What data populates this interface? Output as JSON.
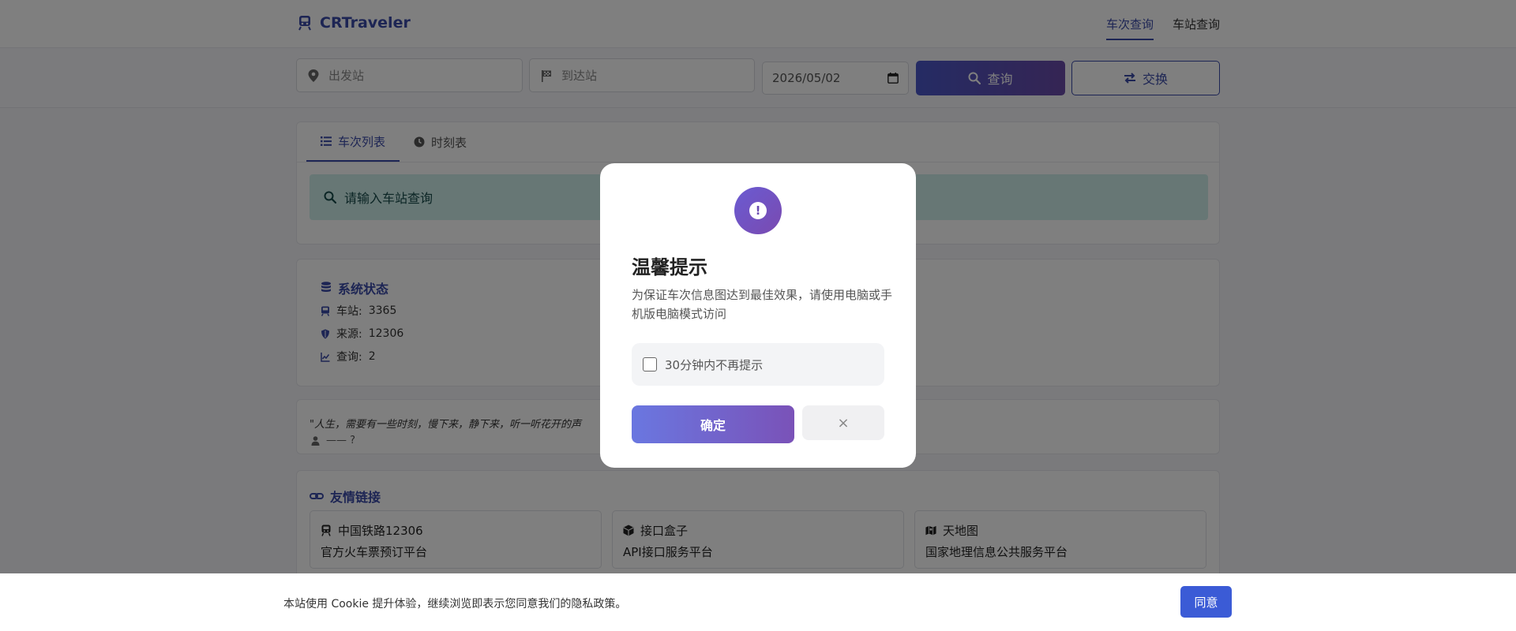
{
  "navbar": {
    "brand": "CRTraveler",
    "links": [
      {
        "label": "车次查询",
        "active": true
      },
      {
        "label": "车站查询",
        "active": false
      }
    ]
  },
  "search": {
    "from_placeholder": "出发站",
    "to_placeholder": "到达站",
    "date_value": "2026/05/02",
    "query_label": "查询",
    "swap_label": "交换"
  },
  "tabs": [
    {
      "label": "车次列表",
      "icon": "list-icon",
      "active": true
    },
    {
      "label": "时刻表",
      "icon": "clock-icon",
      "active": false
    }
  ],
  "info_box": "请输入车站查询",
  "status": {
    "title": "系统状态",
    "items": [
      {
        "label": "车站:",
        "value": "3365",
        "icon": "train-icon"
      },
      {
        "label": "来源:",
        "value": "12306",
        "icon": "shield-icon"
      },
      {
        "label": "查询:",
        "value": "2",
        "icon": "chart-line-icon"
      }
    ]
  },
  "quote": {
    "text": "\"人生，需要有一些时刻，慢下来，静下来，听一听花开的声",
    "author": "—— ?"
  },
  "links": {
    "title": "友情链接",
    "items": [
      {
        "name": "中国铁路12306",
        "desc": "官方火车票预订平台",
        "icon": "train-icon"
      },
      {
        "name": "接口盒子",
        "desc": "API接口服务平台",
        "icon": "cube-icon"
      },
      {
        "name": "天地图",
        "desc": "国家地理信息公共服务平台",
        "icon": "map-icon"
      }
    ]
  },
  "modal": {
    "title": "温馨提示",
    "message": "为保证车次信息图达到最佳效果，请使用电脑或手机版电脑模式访问",
    "checkbox_label": "30分钟内不再提示",
    "ok_label": "确定",
    "close_label": "×"
  },
  "cookie": {
    "text": "本站使用 Cookie 提升体验，继续浏览即表示您同意我们的隐私政策。",
    "agree_label": "同意"
  },
  "colors": {
    "accent": "#3b4aa8",
    "info_bg": "#cfeeea",
    "modal_gradient_start": "#6a77e0",
    "modal_gradient_end": "#7a52b8"
  }
}
